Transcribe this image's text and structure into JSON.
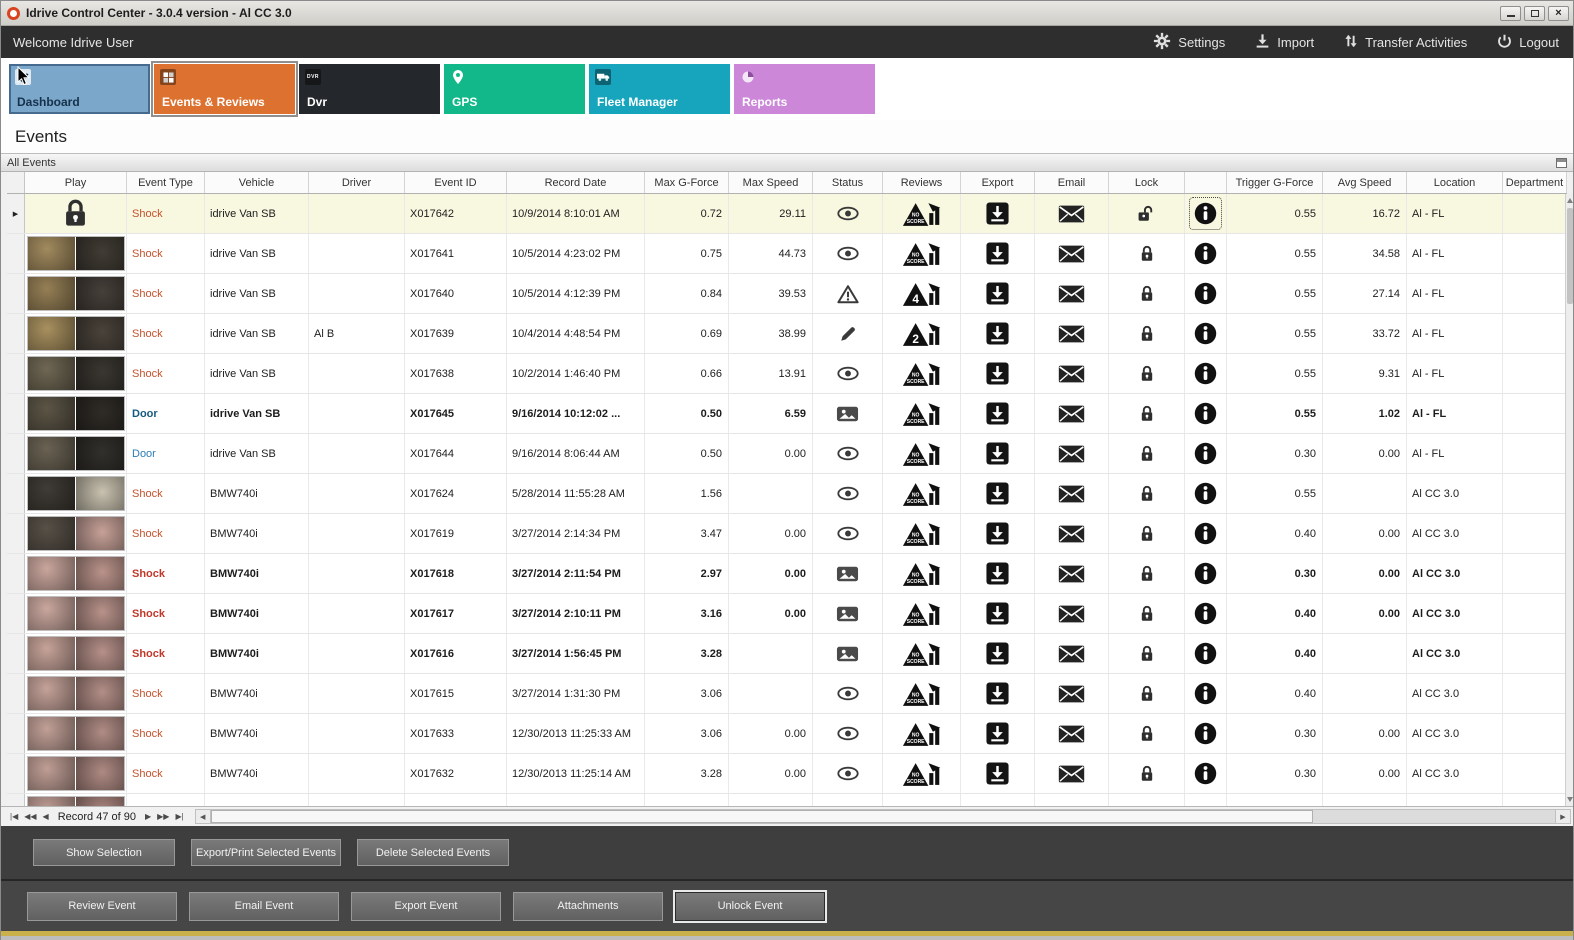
{
  "window": {
    "title": "Idrive Control Center - 3.0.4 version - Al CC 3.0"
  },
  "topbar": {
    "welcome": "Welcome Idrive User",
    "actions": [
      {
        "label": "Settings",
        "icon": "gear-icon"
      },
      {
        "label": "Import",
        "icon": "import-icon"
      },
      {
        "label": "Transfer Activities",
        "icon": "transfer-icon"
      },
      {
        "label": "Logout",
        "icon": "power-icon"
      }
    ]
  },
  "nav_tiles": [
    {
      "label": "Dashboard",
      "color": "#7ba7cb",
      "icon": "check-icon",
      "active": false
    },
    {
      "label": "Events & Reviews",
      "color": "#dd7230",
      "icon": "grid-icon",
      "active": true
    },
    {
      "label": "Dvr",
      "color": "#24272b",
      "icon": "dvr-icon",
      "active": false
    },
    {
      "label": "GPS",
      "color": "#13b88a",
      "icon": "pin-icon",
      "active": false
    },
    {
      "label": "Fleet Manager",
      "color": "#16a5bc",
      "icon": "truck-icon",
      "active": false
    },
    {
      "label": "Reports",
      "color": "#cc87d9",
      "icon": "pie-icon",
      "active": false
    }
  ],
  "page": {
    "title": "Events",
    "panel_title": "All Events"
  },
  "table": {
    "columns": [
      "",
      "Play",
      "Event Type",
      "Vehicle",
      "Driver",
      "Event ID",
      "Record Date",
      "Max G-Force",
      "Max Speed",
      "Status",
      "Reviews",
      "Export",
      "Email",
      "Lock",
      "",
      "Trigger G-Force",
      "Avg Speed",
      "Location",
      "Department"
    ],
    "rows": [
      {
        "selected": true,
        "info_focus": true,
        "play": "lock",
        "type": "Shock",
        "type_color": "#c4512c",
        "vehicle": "idrive Van SB",
        "driver": "",
        "event_id": "X017642",
        "record_date": "10/9/2014 8:10:01 AM",
        "max_g": "0.72",
        "max_speed": "29.11",
        "status": "eye",
        "score": "NO SCORE",
        "unlocked": true,
        "trigger_g": "0.55",
        "avg_speed": "16.72",
        "location": "Al - FL"
      },
      {
        "play": "thumb",
        "thumb": [
          "#a18a5e",
          "#413c34"
        ],
        "type": "Shock",
        "type_color": "#c4512c",
        "vehicle": "idrive Van SB",
        "driver": "",
        "event_id": "X017641",
        "record_date": "10/5/2014 4:23:02 PM",
        "max_g": "0.75",
        "max_speed": "44.73",
        "status": "eye",
        "score": "NO SCORE",
        "trigger_g": "0.55",
        "avg_speed": "34.58",
        "location": "Al - FL"
      },
      {
        "play": "thumb",
        "thumb": [
          "#957f55",
          "#46403a"
        ],
        "type": "Shock",
        "type_color": "#c4512c",
        "vehicle": "idrive Van SB",
        "driver": "",
        "event_id": "X017640",
        "record_date": "10/5/2014 4:12:39 PM",
        "max_g": "0.84",
        "max_speed": "39.53",
        "status": "warning",
        "score": "4",
        "trigger_g": "0.55",
        "avg_speed": "27.14",
        "location": "Al - FL"
      },
      {
        "play": "thumb",
        "thumb": [
          "#a8905f",
          "#4a433b"
        ],
        "type": "Shock",
        "type_color": "#c4512c",
        "vehicle": "idrive Van SB",
        "driver": "Al B",
        "event_id": "X017639",
        "record_date": "10/4/2014 4:48:54 PM",
        "max_g": "0.69",
        "max_speed": "38.99",
        "status": "pencil",
        "score": "2",
        "trigger_g": "0.55",
        "avg_speed": "33.72",
        "location": "Al - FL"
      },
      {
        "play": "thumb",
        "thumb": [
          "#6f6754",
          "#3a3731"
        ],
        "type": "Shock",
        "type_color": "#c4512c",
        "vehicle": "idrive Van SB",
        "driver": "",
        "event_id": "X017638",
        "record_date": "10/2/2014 1:46:40 PM",
        "max_g": "0.66",
        "max_speed": "13.91",
        "status": "eye",
        "score": "NO SCORE",
        "trigger_g": "0.55",
        "avg_speed": "9.31",
        "location": "Al - FL"
      },
      {
        "bold": true,
        "play": "thumb",
        "thumb": [
          "#5c5546",
          "#2f2c27"
        ],
        "type": "Door",
        "type_color": "#155a80",
        "vehicle": "idrive Van SB",
        "driver": "",
        "event_id": "X017645",
        "record_date": "9/16/2014 10:12:02 ...",
        "max_g": "0.50",
        "max_speed": "6.59",
        "status": "image",
        "score": "NO SCORE",
        "trigger_g": "0.55",
        "avg_speed": "1.02",
        "location": "Al - FL"
      },
      {
        "play": "thumb",
        "thumb": [
          "#6a6253",
          "#31302b"
        ],
        "type": "Door",
        "type_color": "#2d7cb5",
        "vehicle": "idrive Van SB",
        "driver": "",
        "event_id": "X017644",
        "record_date": "9/16/2014 8:06:44 AM",
        "max_g": "0.50",
        "max_speed": "0.00",
        "status": "eye",
        "score": "NO SCORE",
        "trigger_g": "0.30",
        "avg_speed": "0.00",
        "location": "Al - FL"
      },
      {
        "play": "thumb",
        "thumb": [
          "#3f3b35",
          "#c9c2b0"
        ],
        "type": "Shock",
        "type_color": "#c4512c",
        "vehicle": "BMW740i",
        "driver": "",
        "event_id": "X017624",
        "record_date": "5/28/2014 11:55:28 AM",
        "max_g": "1.56",
        "max_speed": "",
        "status": "eye",
        "score": "NO SCORE",
        "trigger_g": "0.55",
        "avg_speed": "",
        "location": "Al CC 3.0"
      },
      {
        "play": "thumb",
        "thumb": [
          "#575047",
          "#c7a198"
        ],
        "type": "Shock",
        "type_color": "#c4512c",
        "vehicle": "BMW740i",
        "driver": "",
        "event_id": "X017619",
        "record_date": "3/27/2014 2:14:34 PM",
        "max_g": "3.47",
        "max_speed": "0.00",
        "status": "eye",
        "score": "NO SCORE",
        "trigger_g": "0.40",
        "avg_speed": "0.00",
        "location": "Al CC 3.0"
      },
      {
        "bold": true,
        "play": "thumb",
        "thumb": [
          "#c9a69d",
          "#ba938b"
        ],
        "type": "Shock",
        "type_color": "#c0392b",
        "vehicle": "BMW740i",
        "driver": "",
        "event_id": "X017618",
        "record_date": "3/27/2014 2:11:54 PM",
        "max_g": "2.97",
        "max_speed": "0.00",
        "status": "image",
        "score": "NO SCORE",
        "trigger_g": "0.30",
        "avg_speed": "0.00",
        "location": "Al CC 3.0"
      },
      {
        "bold": true,
        "play": "thumb",
        "thumb": [
          "#c9a79e",
          "#b8928a"
        ],
        "type": "Shock",
        "type_color": "#c0392b",
        "vehicle": "BMW740i",
        "driver": "",
        "event_id": "X017617",
        "record_date": "3/27/2014 2:10:11 PM",
        "max_g": "3.16",
        "max_speed": "0.00",
        "status": "image",
        "score": "NO SCORE",
        "trigger_g": "0.40",
        "avg_speed": "0.00",
        "location": "Al CC 3.0"
      },
      {
        "bold": true,
        "play": "thumb",
        "thumb": [
          "#c6a399",
          "#b69089"
        ],
        "type": "Shock",
        "type_color": "#c0392b",
        "vehicle": "BMW740i",
        "driver": "",
        "event_id": "X017616",
        "record_date": "3/27/2014 1:56:45 PM",
        "max_g": "3.28",
        "max_speed": "",
        "status": "image",
        "score": "NO SCORE",
        "trigger_g": "0.40",
        "avg_speed": "",
        "location": "Al CC 3.0"
      },
      {
        "play": "thumb",
        "thumb": [
          "#c4a299",
          "#b38e87"
        ],
        "type": "Shock",
        "type_color": "#c4512c",
        "vehicle": "BMW740i",
        "driver": "",
        "event_id": "X017615",
        "record_date": "3/27/2014 1:31:30 PM",
        "max_g": "3.06",
        "max_speed": "",
        "status": "eye",
        "score": "NO SCORE",
        "trigger_g": "0.40",
        "avg_speed": "",
        "location": "Al CC 3.0"
      },
      {
        "play": "thumb",
        "thumb": [
          "#c1a097",
          "#b18c85"
        ],
        "type": "Shock",
        "type_color": "#c4512c",
        "vehicle": "BMW740i",
        "driver": "",
        "event_id": "X017633",
        "record_date": "12/30/2013 11:25:33 AM",
        "max_g": "3.06",
        "max_speed": "0.00",
        "status": "eye",
        "score": "NO SCORE",
        "trigger_g": "0.30",
        "avg_speed": "0.00",
        "location": "Al CC 3.0"
      },
      {
        "play": "thumb",
        "thumb": [
          "#bf9e95",
          "#af8a83"
        ],
        "type": "Shock",
        "type_color": "#c4512c",
        "vehicle": "BMW740i",
        "driver": "",
        "event_id": "X017632",
        "record_date": "12/30/2013 11:25:14 AM",
        "max_g": "3.28",
        "max_speed": "0.00",
        "status": "eye",
        "score": "NO SCORE",
        "trigger_g": "0.30",
        "avg_speed": "0.00",
        "location": "Al CC 3.0"
      },
      {
        "partial": true,
        "play": "thumb",
        "thumb": [
          "#bd9b93",
          "#ad8780"
        ]
      }
    ]
  },
  "record_bar": {
    "label": "Record 47 of 90"
  },
  "selection_buttons": [
    "Show Selection",
    "Export/Print Selected Events",
    "Delete Selected  Events"
  ],
  "event_buttons": [
    "Review Event",
    "Email Event",
    "Export Event",
    "Attachments",
    "Unlock Event"
  ]
}
